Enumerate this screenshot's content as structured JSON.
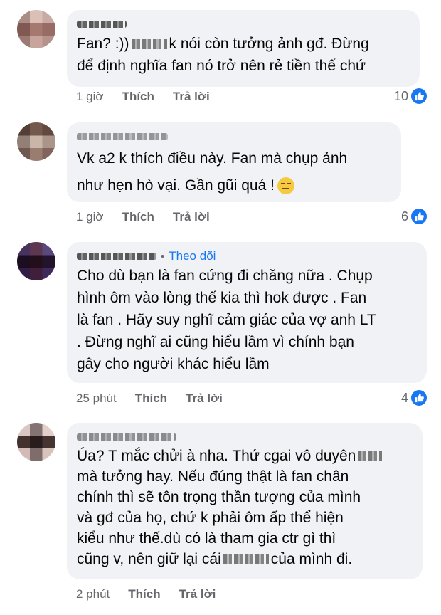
{
  "comments": [
    {
      "author": "Đinh Bal",
      "text": "Fan? :)) ▌▌ ▖ k nói còn tưởng ảnh gđ. Đừng để định nghĩa fan nó trở nên rẻ tiền thế chứ",
      "lines": [
        "Fan? :))",
        "k nói còn tưởng ảnh gđ. Đừng",
        "để định nghĩa fan nó trở nên rẻ tiền thế chứ"
      ],
      "time": "1 giờ",
      "like": "Thích",
      "reply": "Trả lời",
      "reactions": "10"
    },
    {
      "author": "Thuận Văn Đức",
      "lines": [
        "Vk a2 k thích điều này. Fan mà chụp ảnh",
        "như hẹn hò vại. Gần gũi quá !"
      ],
      "time": "1 giờ",
      "like": "Thích",
      "reply": "Trả lời",
      "reactions": "6",
      "emoji": "expressionless-emoji"
    },
    {
      "author": "T uần Đội",
      "follow": "Theo dõi",
      "lines": [
        "Cho dù bạn là fan cứng đi chăng nữa . Chụp",
        "hình ôm vào lòng thế kia thì hok được . Fan",
        "là fan . Hãy suy nghĩ cảm giác của vợ anh LT",
        ". Đừng nghĩ ai cũng hiểu lầm vì chính bạn",
        "gây cho người khác hiểu lầm"
      ],
      "time": "25 phút",
      "like": "Thích",
      "reply": "Trả lời",
      "reactions": "4"
    },
    {
      "author": "Hoài Thị Tùng",
      "lines": [
        "Úa? T mắc chửi à nha. Thứ cgai vô duyên",
        "mà tưởng hay. Nếu đúng thật là fan chân",
        "chính thì sẽ tôn trọng thần tượng của mình",
        "và gđ của họ, chứ k phải ôm ấp thể hiện",
        "kiểu như thế.dù có là tham gia ctr gì thì",
        "cũng v, nên giữ lại cái",
        "của mình đi."
      ],
      "time": "2 phút",
      "like": "Thích",
      "reply": "Trả lời"
    }
  ],
  "colors": {
    "bubble": "#f0f2f5",
    "link": "#1877f2",
    "meta": "#65676b"
  },
  "icons": {
    "like": "like-thumb-icon"
  }
}
